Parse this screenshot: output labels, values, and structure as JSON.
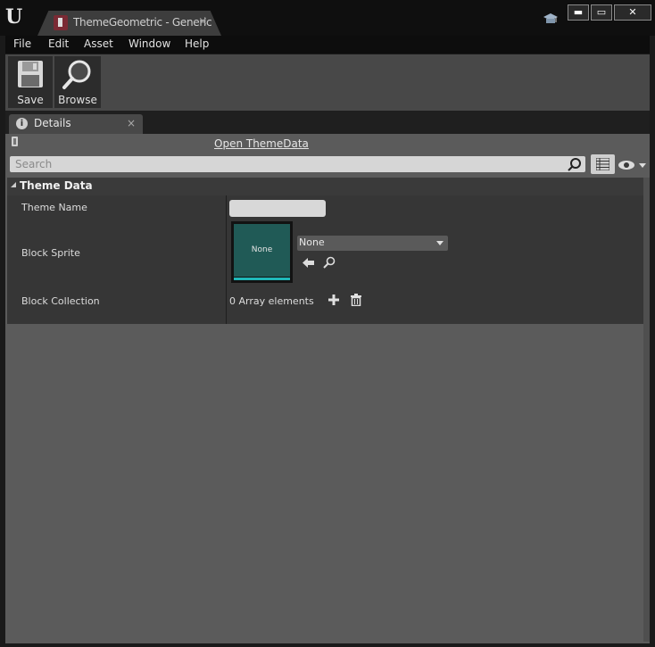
{
  "titlebar": {
    "tab_title": "ThemeGeometric - Generic",
    "tab_close": "×",
    "window_buttons": {
      "minimize": "▬",
      "maximize": "▭",
      "close": "✕"
    }
  },
  "menu": {
    "items": [
      "File",
      "Edit",
      "Asset",
      "Window",
      "Help"
    ]
  },
  "toolbar": {
    "save_label": "Save",
    "browse_label": "Browse"
  },
  "details": {
    "tab_label": "Details",
    "tab_close": "×",
    "open_link": "Open ThemeData",
    "search_placeholder": "Search",
    "category_label": "Theme Data",
    "properties": {
      "theme_name_label": "Theme Name",
      "theme_name_value": "",
      "block_sprite_label": "Block Sprite",
      "block_sprite_thumb_text": "None",
      "block_sprite_value": "None",
      "block_collection_label": "Block Collection",
      "block_collection_value": "0 Array elements"
    }
  },
  "colors": {
    "thumbnail_bg": "#205a56",
    "thumbnail_bar": "#1fb8b8",
    "panel_bg": "#5b5b5b",
    "category_bg": "#3a3a3a"
  }
}
